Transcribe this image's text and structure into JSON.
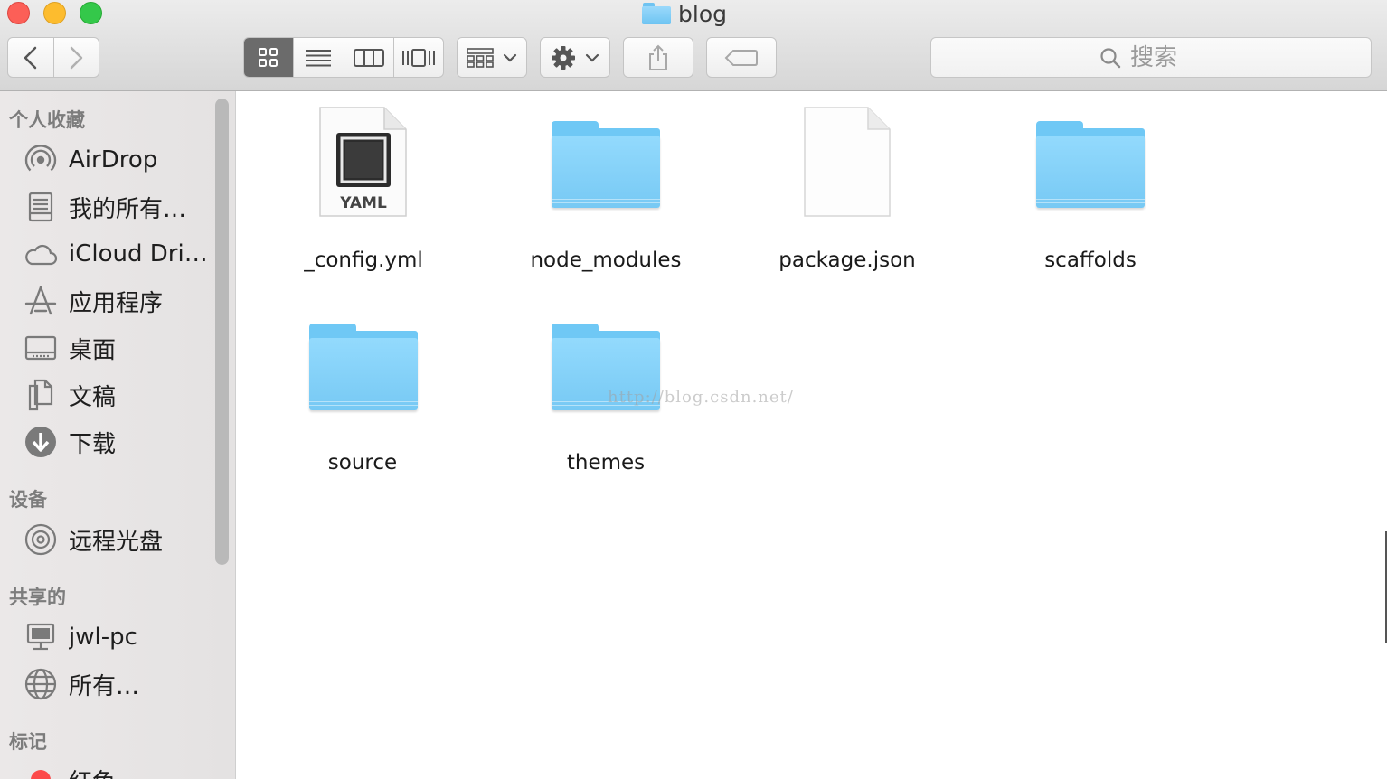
{
  "window": {
    "title": "blog",
    "title_icon": "folder-icon"
  },
  "toolbar": {
    "nav_back_icon": "chevron-left-icon",
    "nav_forward_icon": "chevron-right-icon",
    "view_modes": [
      "icon-view",
      "list-view",
      "column-view",
      "cover-flow-view"
    ],
    "active_view": "icon-view",
    "arrange_icon": "arrange-grid-icon",
    "action_icon": "gear-icon",
    "share_icon": "share-icon",
    "tag_icon": "tag-icon",
    "search_placeholder": "搜索"
  },
  "sidebar": {
    "sections": [
      {
        "header": "个人收藏",
        "items": [
          {
            "label": "AirDrop",
            "icon": "airdrop-icon"
          },
          {
            "label": "我的所有…",
            "icon": "all-files-icon"
          },
          {
            "label": "iCloud Dri…",
            "icon": "cloud-icon"
          },
          {
            "label": "应用程序",
            "icon": "applications-icon"
          },
          {
            "label": "桌面",
            "icon": "desktop-icon"
          },
          {
            "label": "文稿",
            "icon": "documents-icon"
          },
          {
            "label": "下载",
            "icon": "download-icon"
          }
        ]
      },
      {
        "header": "设备",
        "items": [
          {
            "label": "远程光盘",
            "icon": "disc-icon"
          }
        ]
      },
      {
        "header": "共享的",
        "items": [
          {
            "label": "jwl-pc",
            "icon": "computer-icon"
          },
          {
            "label": "所有…",
            "icon": "network-icon"
          }
        ]
      },
      {
        "header": "标记",
        "items": [
          {
            "label": "红色",
            "icon": "red-tag-icon"
          }
        ]
      }
    ]
  },
  "files": [
    {
      "name": "_config.yml",
      "kind": "yaml",
      "badge": "YAML"
    },
    {
      "name": "node_modules",
      "kind": "folder"
    },
    {
      "name": "package.json",
      "kind": "document"
    },
    {
      "name": "scaffolds",
      "kind": "folder"
    },
    {
      "name": "source",
      "kind": "folder"
    },
    {
      "name": "themes",
      "kind": "folder"
    }
  ],
  "watermark": "http://blog.csdn.net/",
  "colors": {
    "folder": "#77c9f4",
    "close": "#fc5f57",
    "minimize": "#fdbc2e",
    "zoom": "#34c84a",
    "tag_red": "#fc4a4a"
  }
}
